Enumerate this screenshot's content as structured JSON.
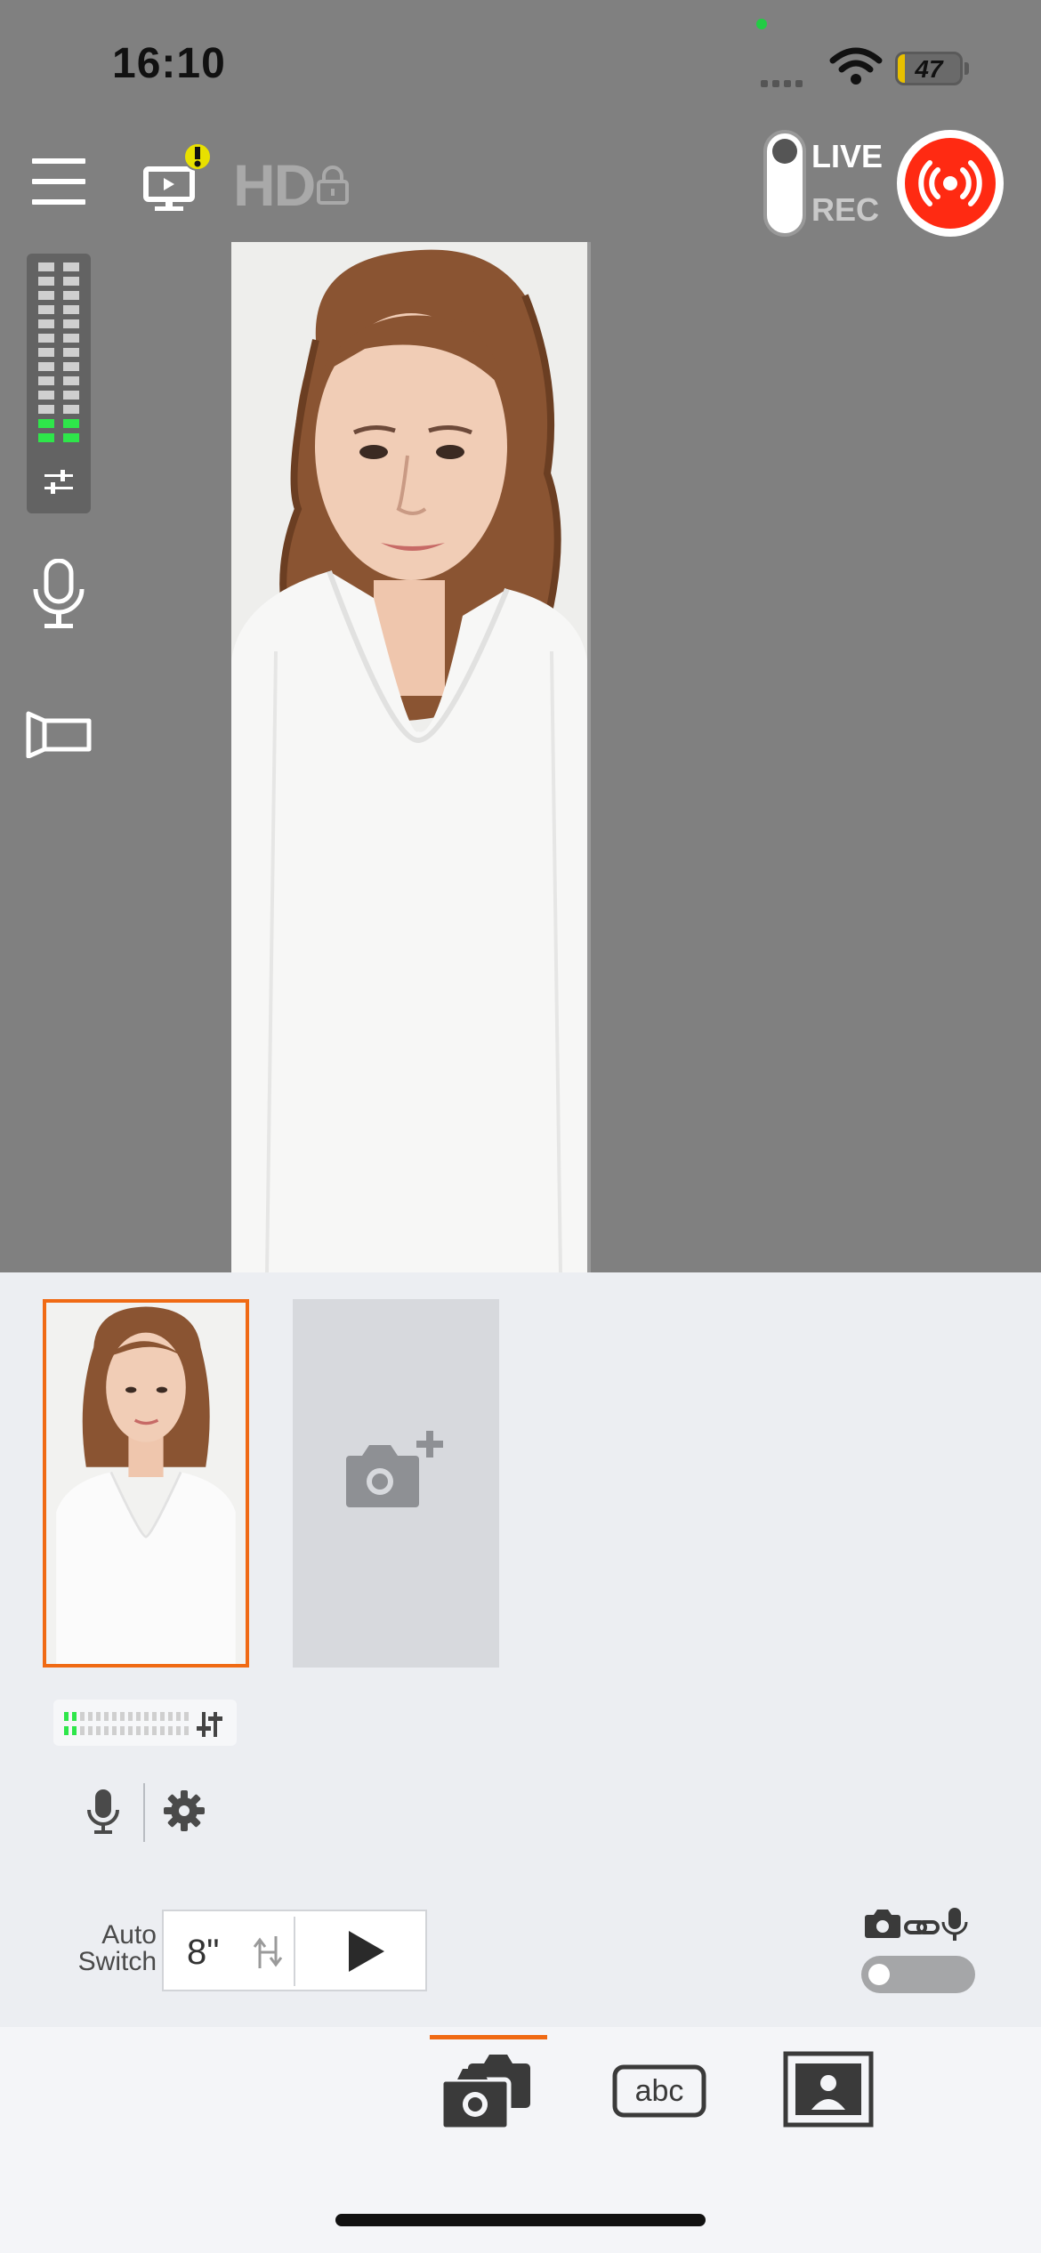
{
  "status_bar": {
    "time": "16:10",
    "battery": "47"
  },
  "header": {
    "quality": "HD",
    "live_label": "LIVE",
    "rec_label": "REC"
  },
  "colors": {
    "accent": "#f06a14",
    "broadcast": "#ff2a12",
    "meter_green": "#2ee64a"
  },
  "icons": [
    "menu-icon",
    "monitor-warning-icon",
    "lock-icon",
    "broadcast-icon",
    "sliders-icon",
    "microphone-icon",
    "rotate-screen-icon",
    "add-camera-icon",
    "gear-icon",
    "cycle-icon",
    "play-icon",
    "camera-link-mic-icon",
    "cameras-icon",
    "text-abc-icon",
    "image-icon"
  ],
  "sources": {
    "active_index": 0,
    "add_label": ""
  },
  "auto_switch": {
    "label_line1": "Auto",
    "label_line2": "Switch",
    "interval": "8\"",
    "enabled": false
  },
  "tabs": {
    "text_tab_label": "abc",
    "active": "cameras"
  }
}
